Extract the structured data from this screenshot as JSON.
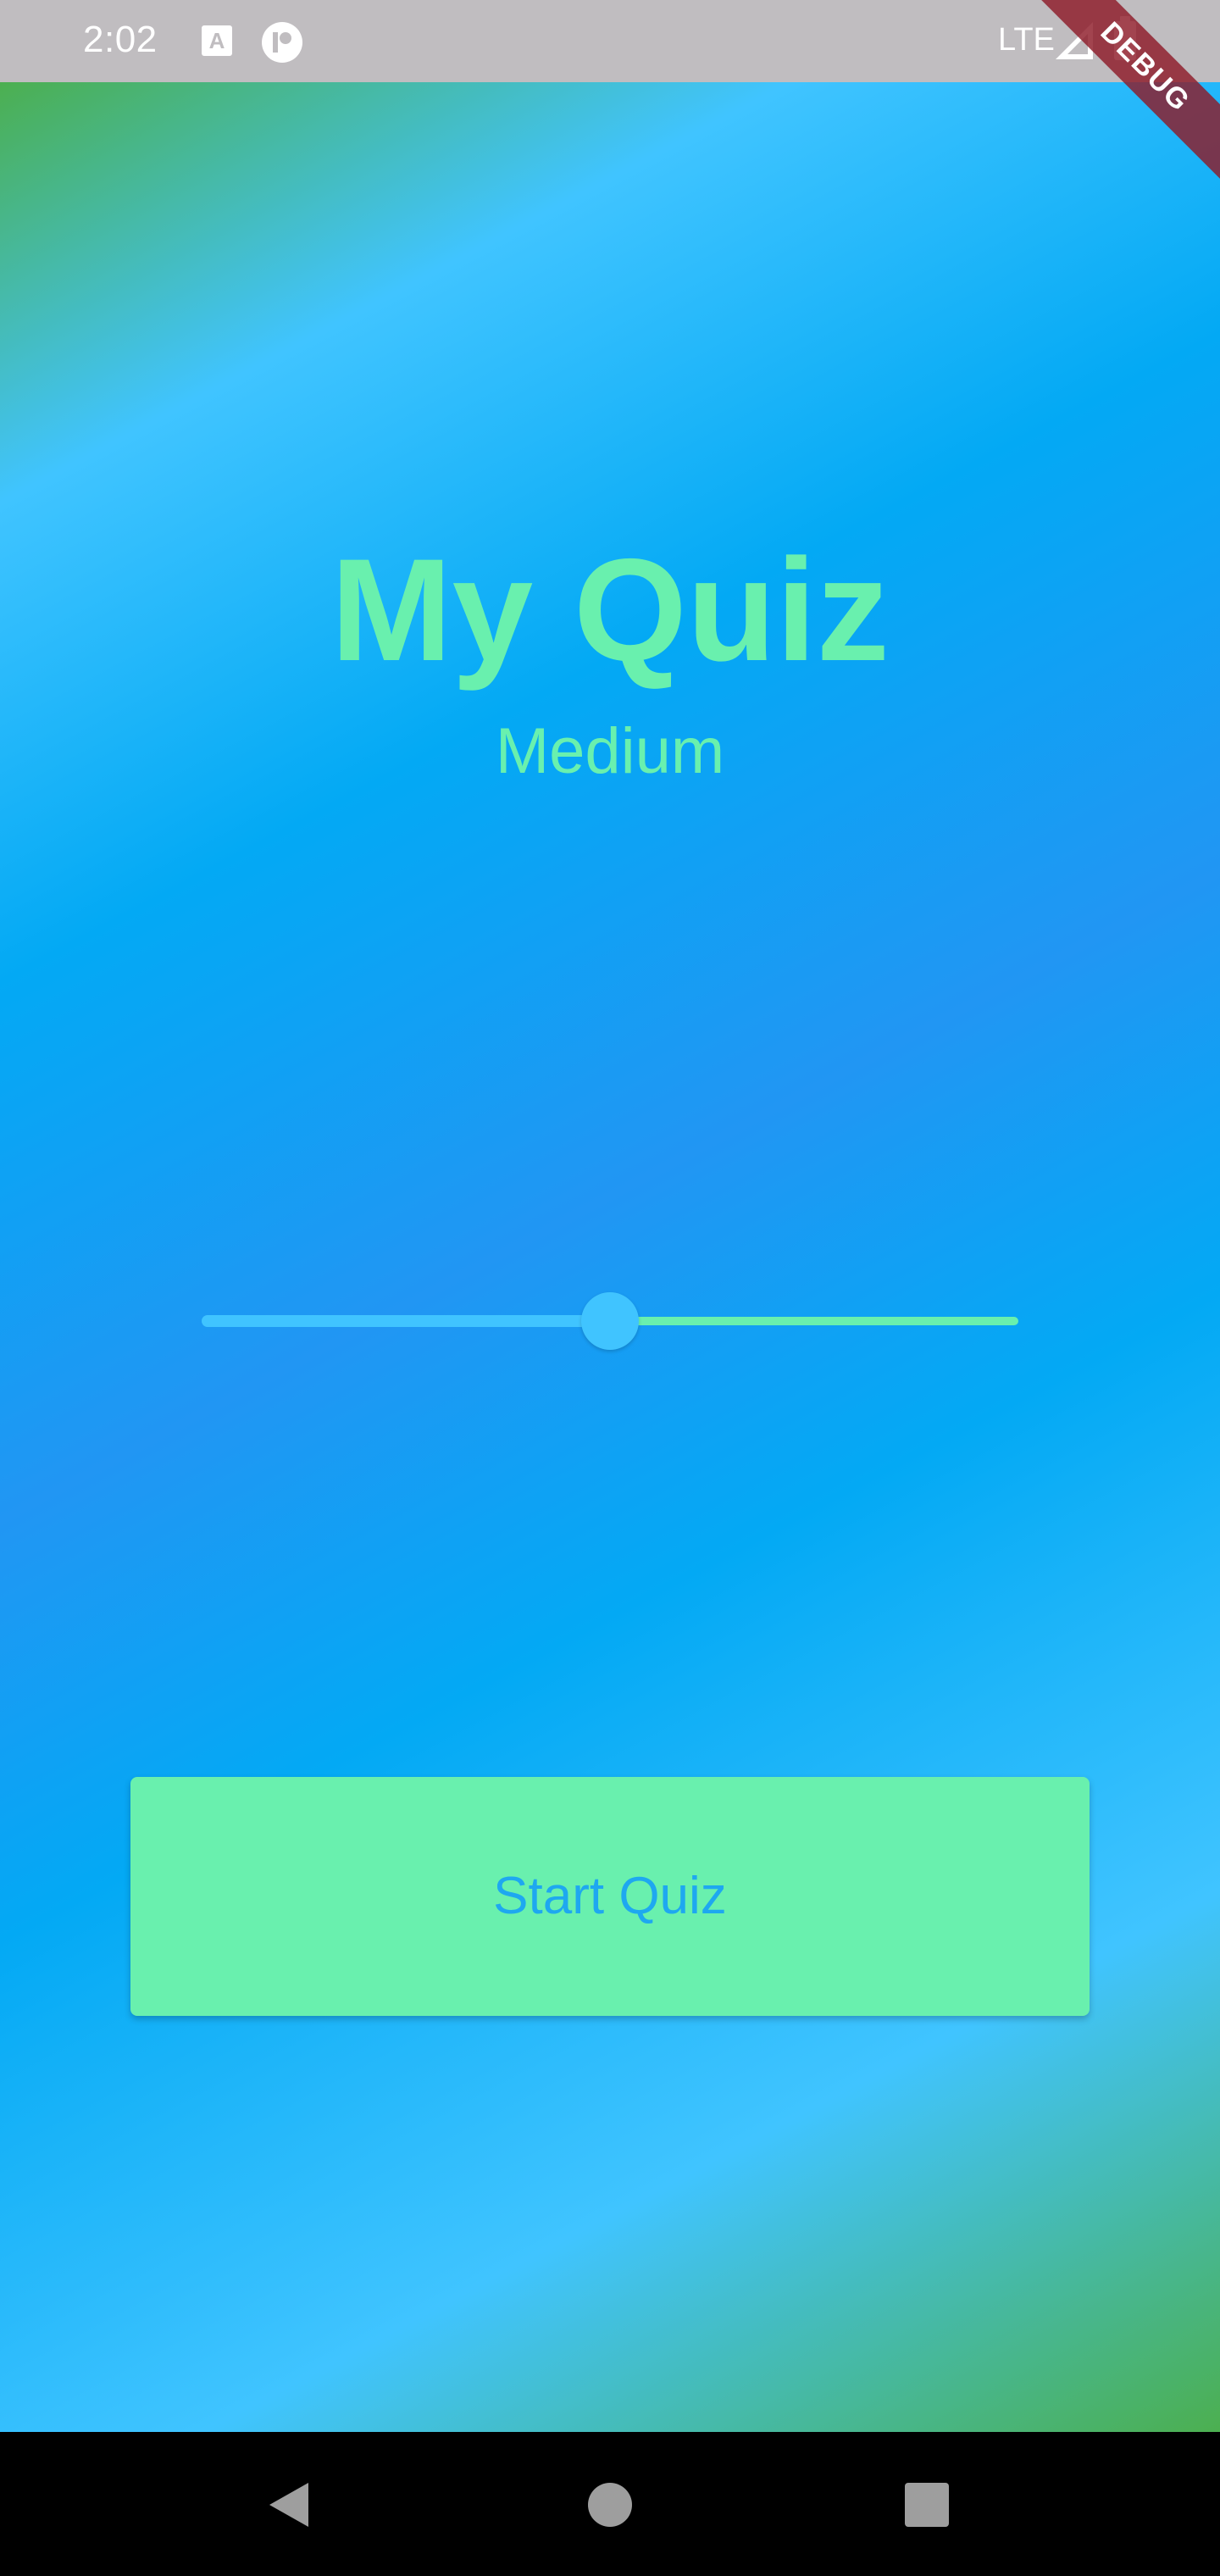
{
  "status_bar": {
    "time": "2:02",
    "network_label": "LTE",
    "icons": [
      "a-notification-icon",
      "circle-app-icon",
      "signal-icon",
      "battery-icon"
    ]
  },
  "debug_banner": {
    "label": "DEBUG"
  },
  "main": {
    "title": "My Quiz",
    "difficulty_label": "Medium",
    "difficulty_slider": {
      "value": 0.5
    },
    "start_button_label": "Start Quiz"
  },
  "colors": {
    "accent_green": "#69f0ae",
    "light_blue": "#40c4ff",
    "blue": "#2196f3",
    "gradient_green": "#4caf50",
    "button_text": "#1ea8f0"
  },
  "nav_bar": {
    "icons": [
      "back-icon",
      "home-icon",
      "recents-icon"
    ]
  }
}
